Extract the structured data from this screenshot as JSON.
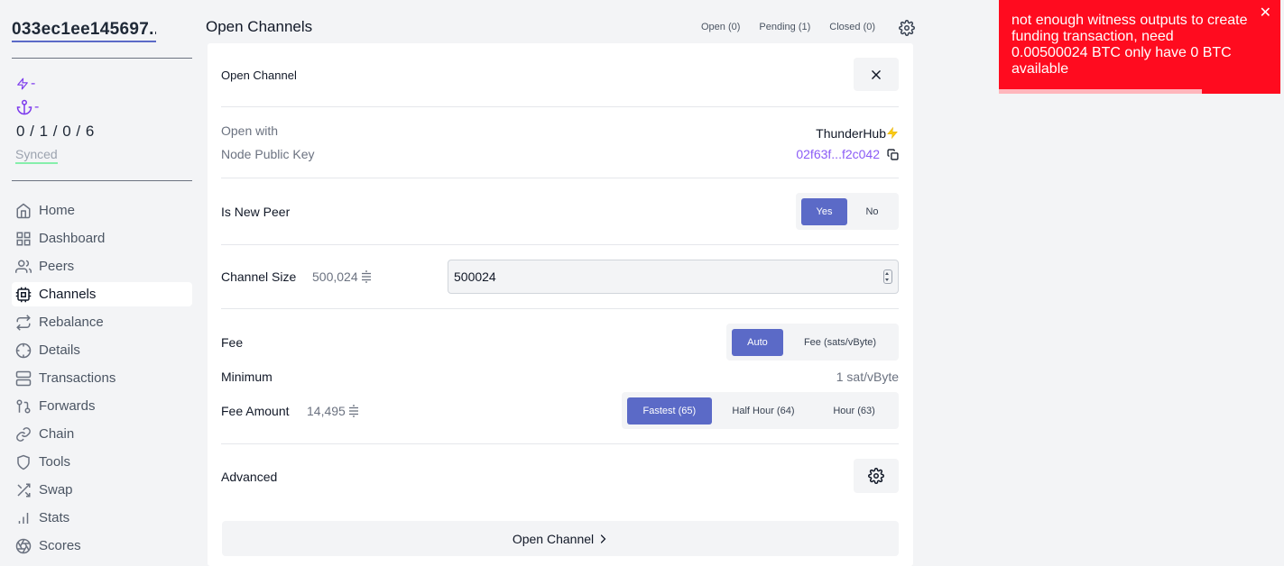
{
  "sidebar": {
    "node_alias": "033ec1ee145697...",
    "lightning_value": "-",
    "chain_value": "-",
    "channel_counts": "0 / 1 / 0 / 6",
    "sync_status": "Synced",
    "nav": [
      {
        "label": "Home",
        "icon": "home-icon"
      },
      {
        "label": "Dashboard",
        "icon": "grid-icon"
      },
      {
        "label": "Peers",
        "icon": "users-icon"
      },
      {
        "label": "Channels",
        "icon": "cpu-icon",
        "active": true
      },
      {
        "label": "Rebalance",
        "icon": "repeat-icon"
      },
      {
        "label": "Details",
        "icon": "crosshair-icon"
      },
      {
        "label": "Transactions",
        "icon": "server-icon"
      },
      {
        "label": "Forwards",
        "icon": "git-pull-request-icon"
      },
      {
        "label": "Chain",
        "icon": "link-icon"
      },
      {
        "label": "Tools",
        "icon": "shield-icon"
      },
      {
        "label": "Swap",
        "icon": "shuffle-icon"
      },
      {
        "label": "Stats",
        "icon": "bar-chart-icon"
      },
      {
        "label": "Scores",
        "icon": "aperture-icon"
      }
    ]
  },
  "header": {
    "title": "Open Channels",
    "tabs": [
      "Open (0)",
      "Pending (1)",
      "Closed (0)"
    ]
  },
  "card": {
    "title": "Open Channel",
    "open_with_label": "Open with",
    "open_with_value": "ThunderHub",
    "pubkey_label": "Node Public Key",
    "pubkey_value": "02f63f...f2c042",
    "new_peer_label": "Is New Peer",
    "new_peer_options": [
      "Yes",
      "No"
    ],
    "new_peer_selected": "Yes",
    "channel_size_label": "Channel Size",
    "channel_size_display": "500,024",
    "channel_size_input": "500024",
    "fee_label": "Fee",
    "fee_options": [
      "Auto",
      "Fee (sats/vByte)"
    ],
    "fee_selected": "Auto",
    "minimum_label": "Minimum",
    "minimum_value": "1 sat/vByte",
    "fee_amount_label": "Fee Amount",
    "fee_amount_display": "14,495",
    "fee_speed_options": [
      "Fastest (65)",
      "Half Hour (64)",
      "Hour (63)"
    ],
    "fee_speed_selected": "Fastest (65)",
    "advanced_label": "Advanced",
    "submit_label": "Open Channel"
  },
  "toast": {
    "message": "not enough witness outputs to create funding transaction, need 0.00500024 BTC only have 0 BTC available",
    "close": "✕",
    "color": "#ff0b1f"
  },
  "colors": {
    "accent": "#5b6ac7",
    "purple": "#8b5cf6",
    "background": "#f3f4f6"
  }
}
